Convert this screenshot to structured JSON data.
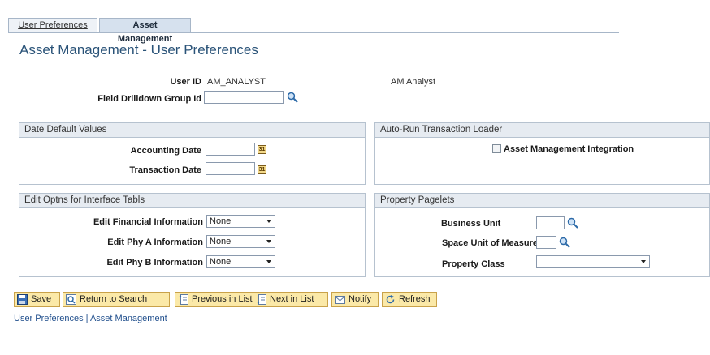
{
  "tabs": [
    {
      "label": "User Preferences"
    },
    {
      "label": "Asset Management"
    }
  ],
  "page_title": "Asset Management - User Preferences",
  "user": {
    "user_id_label": "User ID",
    "user_id_value": "AM_ANALYST",
    "user_name": "AM Analyst",
    "drilldown_label": "Field Drilldown Group Id",
    "drilldown_value": ""
  },
  "date_defaults": {
    "title": "Date Default Values",
    "accounting_label": "Accounting Date",
    "accounting_value": "",
    "transaction_label": "Transaction Date",
    "transaction_value": ""
  },
  "auto_run": {
    "title": "Auto-Run Transaction Loader",
    "checkbox_label": "Asset Management Integration",
    "checked": false
  },
  "edit_optns": {
    "title": "Edit Optns for Interface Tabls",
    "fin_label": "Edit Financial Information",
    "fin_value": "None",
    "phya_label": "Edit Phy A Information",
    "phya_value": "None",
    "phyb_label": "Edit Phy B Information",
    "phyb_value": "None"
  },
  "property": {
    "title": "Property Pagelets",
    "bu_label": "Business Unit",
    "bu_value": "",
    "space_label": "Space Unit of Measure",
    "space_value": "",
    "class_label": "Property Class",
    "class_value": ""
  },
  "toolbar": {
    "save": "Save",
    "return": "Return to Search",
    "previous": "Previous in List",
    "next": "Next in List",
    "notify": "Notify",
    "refresh": "Refresh"
  },
  "footer": {
    "link1": "User Preferences",
    "separator": " | ",
    "link2": "Asset Management"
  },
  "icons": {
    "lookup": "magnifier-icon",
    "calendar": "calendar-icon"
  }
}
